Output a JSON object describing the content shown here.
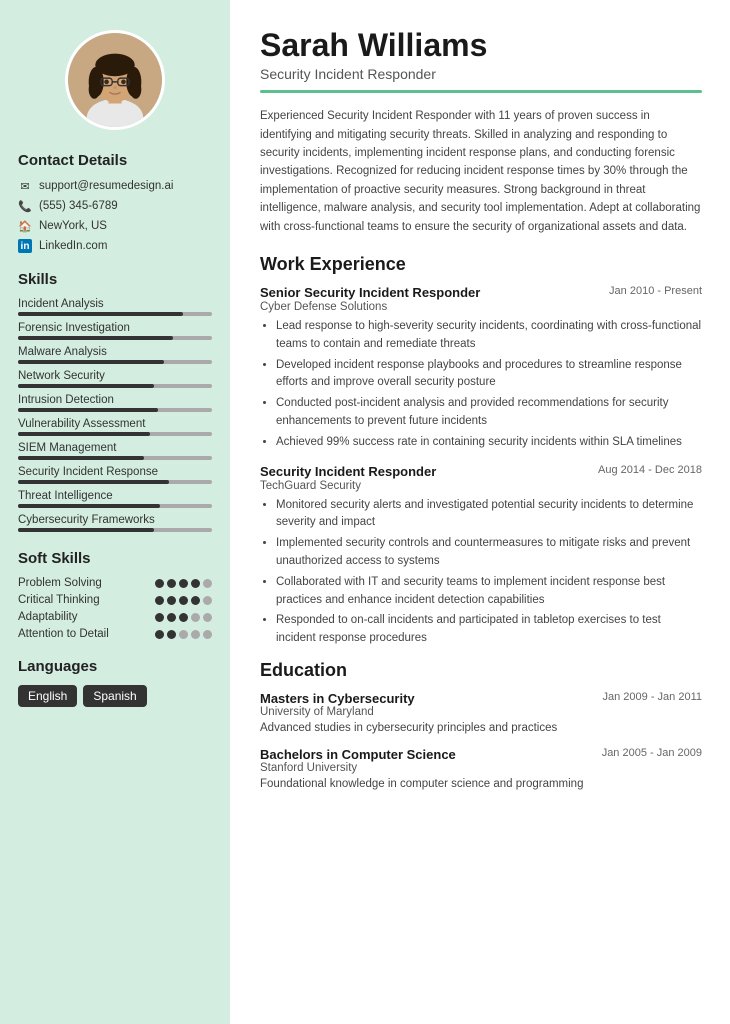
{
  "sidebar": {
    "contact": {
      "title": "Contact Details",
      "items": [
        {
          "icon": "email",
          "text": "support@resumedesign.ai"
        },
        {
          "icon": "phone",
          "text": "(555) 345-6789"
        },
        {
          "icon": "home",
          "text": "NewYork, US"
        },
        {
          "icon": "linkedin",
          "text": "LinkedIn.com"
        }
      ]
    },
    "skills": {
      "title": "Skills",
      "items": [
        {
          "name": "Incident Analysis",
          "pct": 85
        },
        {
          "name": "Forensic Investigation",
          "pct": 80
        },
        {
          "name": "Malware Analysis",
          "pct": 75
        },
        {
          "name": "Network Security",
          "pct": 70
        },
        {
          "name": "Intrusion Detection",
          "pct": 72
        },
        {
          "name": "Vulnerability Assessment",
          "pct": 68
        },
        {
          "name": "SIEM Management",
          "pct": 65
        },
        {
          "name": "Security Incident Response",
          "pct": 78
        },
        {
          "name": "Threat Intelligence",
          "pct": 73
        },
        {
          "name": "Cybersecurity Frameworks",
          "pct": 70
        }
      ]
    },
    "soft_skills": {
      "title": "Soft Skills",
      "items": [
        {
          "name": "Problem Solving",
          "filled": 4,
          "total": 5
        },
        {
          "name": "Critical Thinking",
          "filled": 4,
          "total": 5
        },
        {
          "name": "Adaptability",
          "filled": 3,
          "total": 5
        },
        {
          "name": "Attention to Detail",
          "filled": 2,
          "total": 5
        }
      ]
    },
    "languages": {
      "title": "Languages",
      "items": [
        "English",
        "Spanish"
      ]
    }
  },
  "main": {
    "name": "Sarah Williams",
    "job_title": "Security Incident Responder",
    "summary": "Experienced Security Incident Responder with 11 years of proven success in identifying and mitigating security threats. Skilled in analyzing and responding to security incidents, implementing incident response plans, and conducting forensic investigations. Recognized for reducing incident response times by 30% through the implementation of proactive security measures. Strong background in threat intelligence, malware analysis, and security tool implementation. Adept at collaborating with cross-functional teams to ensure the security of organizational assets and data.",
    "work_experience": {
      "title": "Work Experience",
      "jobs": [
        {
          "title": "Senior Security Incident Responder",
          "date": "Jan 2010 - Present",
          "company": "Cyber Defense Solutions",
          "bullets": [
            "Lead response to high-severity security incidents, coordinating with cross-functional teams to contain and remediate threats",
            "Developed incident response playbooks and procedures to streamline response efforts and improve overall security posture",
            "Conducted post-incident analysis and provided recommendations for security enhancements to prevent future incidents",
            "Achieved 99% success rate in containing security incidents within SLA timelines"
          ]
        },
        {
          "title": "Security Incident Responder",
          "date": "Aug 2014 - Dec 2018",
          "company": "TechGuard Security",
          "bullets": [
            "Monitored security alerts and investigated potential security incidents to determine severity and impact",
            "Implemented security controls and countermeasures to mitigate risks and prevent unauthorized access to systems",
            "Collaborated with IT and security teams to implement incident response best practices and enhance incident detection capabilities",
            "Responded to on-call incidents and participated in tabletop exercises to test incident response procedures"
          ]
        }
      ]
    },
    "education": {
      "title": "Education",
      "items": [
        {
          "degree": "Masters in Cybersecurity",
          "date": "Jan 2009 - Jan 2011",
          "school": "University of Maryland",
          "desc": "Advanced studies in cybersecurity principles and practices"
        },
        {
          "degree": "Bachelors in Computer Science",
          "date": "Jan 2005 - Jan 2009",
          "school": "Stanford University",
          "desc": "Foundational knowledge in computer science and programming"
        }
      ]
    }
  }
}
